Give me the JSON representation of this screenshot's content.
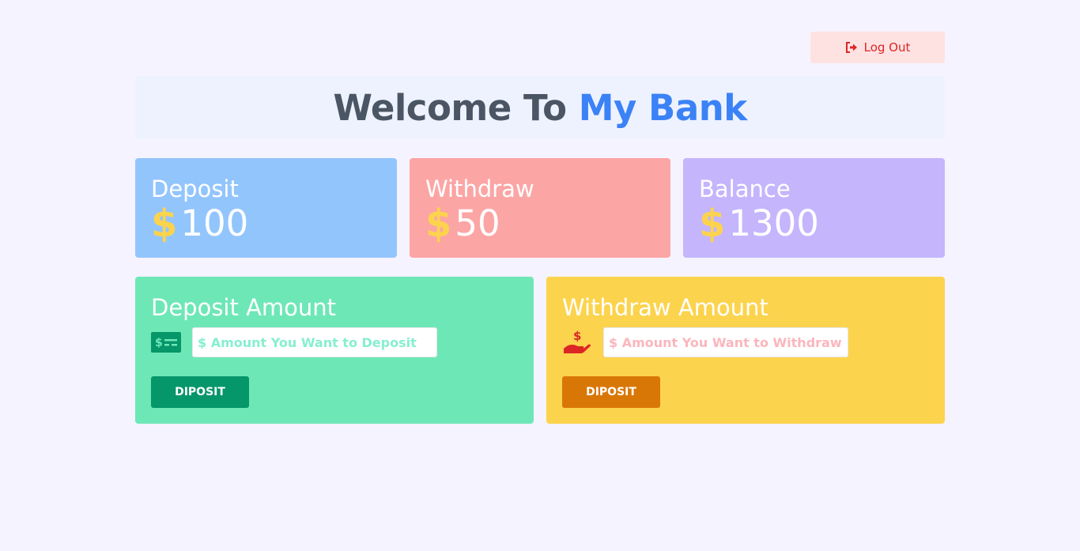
{
  "logout": {
    "label": "Log Out",
    "icon": "sign-out-icon",
    "color": "#dc2626"
  },
  "header": {
    "title_prefix": "Welcome To",
    "title_brand": "My Bank"
  },
  "stats": {
    "deposit": {
      "label": "Deposit",
      "currency": "$",
      "value": "100"
    },
    "withdraw": {
      "label": "Withdraw",
      "currency": "$",
      "value": "50"
    },
    "balance": {
      "label": "Balance",
      "currency": "$",
      "value": "1300"
    }
  },
  "deposit_card": {
    "title": "Deposit Amount",
    "icon": "money-check-icon",
    "placeholder": "$ Amount You Want to Deposit",
    "button": "DIPOSIT"
  },
  "withdraw_card": {
    "title": "Withdraw Amount",
    "icon": "hand-holding-dollar-icon",
    "placeholder": "$ Amount You Want to Withdraw",
    "button": "DIPOSIT"
  },
  "colors": {
    "background": "#f5f3ff",
    "brand": "#3b82f6",
    "deposit_stat": "#93c5fd",
    "withdraw_stat": "#fca5a5",
    "balance_stat": "#c4b5fd",
    "deposit_card": "#6ee7b7",
    "withdraw_card": "#fcd34d"
  }
}
